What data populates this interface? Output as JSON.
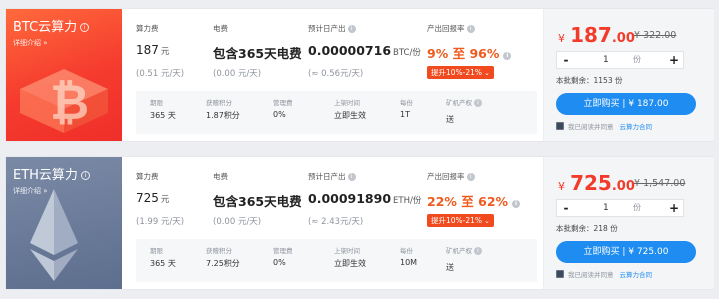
{
  "colors": {
    "accent_red": "#f23b2b",
    "accent_orange": "#f05a1e",
    "buy_blue": "#1e8cf0"
  },
  "labels": {
    "hashrate_fee": "算力费",
    "electricity_fee": "电费",
    "expected_daily_output": "预计日产出",
    "return_rate": "产出回报率",
    "detail_link": "详细介绍",
    "buy_prefix": "立即购买",
    "agree_text": "我已阅读并同意",
    "contract_link": "云算力合同",
    "qty_unit": "份",
    "minus": "-",
    "plus": "+",
    "info_mark": "i",
    "currency": "¥",
    "to": "至"
  },
  "products": [
    {
      "title": "BTC云算力",
      "hashrate_price": "187",
      "hashrate_unit": "元",
      "hashrate_daily": "(0.51 元/天)",
      "electricity": "包含365天电费",
      "electricity_daily": "(0.00 元/天)",
      "output": "0.00000716",
      "output_unit": "BTC/份",
      "output_cny": "(≈ 0.56元/天)",
      "return_low": "9%",
      "return_high": "96%",
      "boost": "提升10%-21%",
      "details": [
        {
          "label": "期限",
          "value": "365 天"
        },
        {
          "label": "获赠积分",
          "value": "1.87积分"
        },
        {
          "label": "管理费",
          "value": "0%"
        },
        {
          "label": "上架时间",
          "value": "立即生效"
        },
        {
          "label": "每份",
          "value": "1T"
        },
        {
          "label": "矿机产权",
          "value": "送"
        }
      ],
      "price": "187",
      "price_decimal": ".00",
      "orig_price": "¥ 322.00",
      "qty": "1",
      "remaining": "本批剩余：1153 份",
      "buy_price": "187.00"
    },
    {
      "title": "ETH云算力",
      "hashrate_price": "725",
      "hashrate_unit": "元",
      "hashrate_daily": "(1.99 元/天)",
      "electricity": "包含365天电费",
      "electricity_daily": "(0.00 元/天)",
      "output": "0.00091890",
      "output_unit": "ETH/份",
      "output_cny": "(≈ 2.43元/天)",
      "return_low": "22%",
      "return_high": "62%",
      "boost": "提升10%-21%",
      "details": [
        {
          "label": "期限",
          "value": "365 天"
        },
        {
          "label": "获赠积分",
          "value": "7.25积分"
        },
        {
          "label": "管理费",
          "value": "0%"
        },
        {
          "label": "上架时间",
          "value": "立即生效"
        },
        {
          "label": "每份",
          "value": "10M"
        },
        {
          "label": "矿机产权",
          "value": "送"
        }
      ],
      "price": "725",
      "price_decimal": ".00",
      "orig_price": "¥ 1,547.00",
      "qty": "1",
      "remaining": "本批剩余：218 份",
      "buy_price": "725.00"
    }
  ]
}
